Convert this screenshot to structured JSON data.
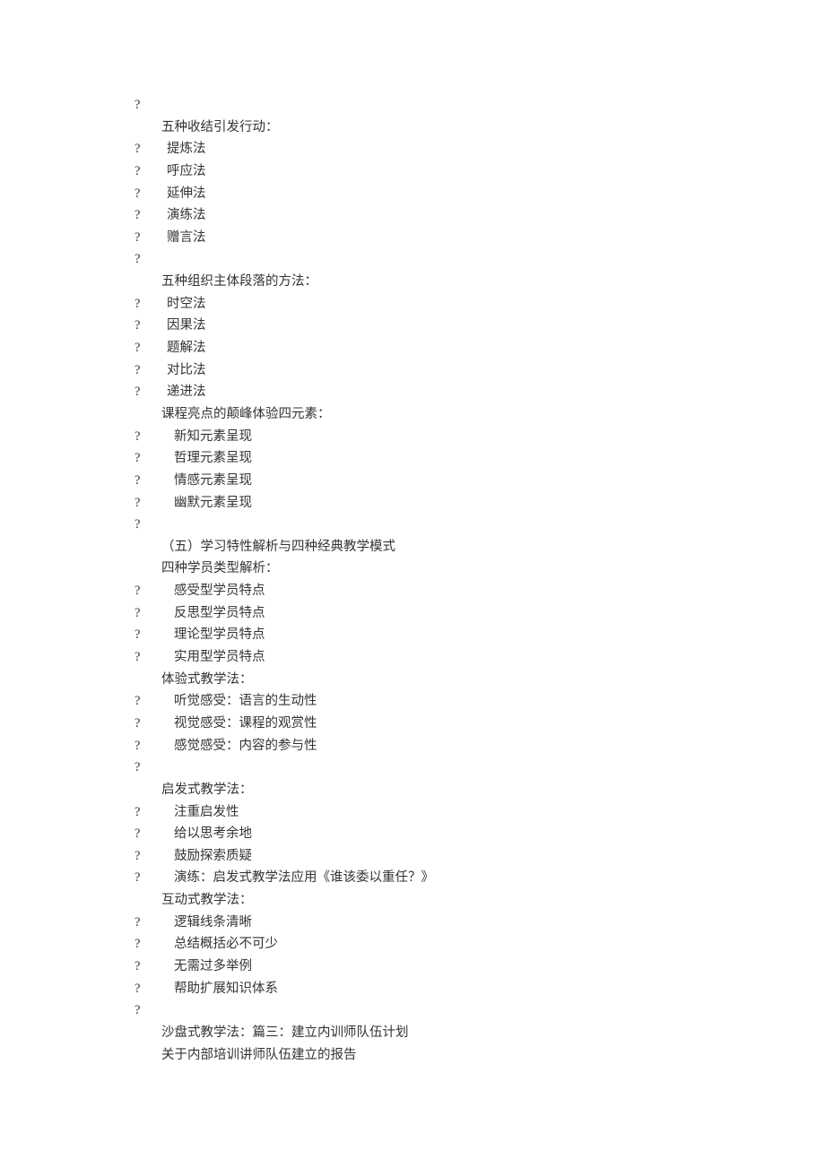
{
  "lines": [
    {
      "type": "q",
      "text": ""
    },
    {
      "type": "indent",
      "text": "五种收结引发行动："
    },
    {
      "type": "qitem",
      "text": "提炼法"
    },
    {
      "type": "qitem",
      "text": "呼应法"
    },
    {
      "type": "qitem",
      "text": "延伸法"
    },
    {
      "type": "qitem",
      "text": "演练法"
    },
    {
      "type": "qitem",
      "text": "赠言法"
    },
    {
      "type": "q",
      "text": ""
    },
    {
      "type": "indent",
      "text": "五种组织主体段落的方法："
    },
    {
      "type": "qitem",
      "text": "时空法"
    },
    {
      "type": "qitem",
      "text": "因果法"
    },
    {
      "type": "qitem",
      "text": "题解法"
    },
    {
      "type": "qitem",
      "text": "对比法"
    },
    {
      "type": "qitem",
      "text": "递进法"
    },
    {
      "type": "indent",
      "text": "课程亮点的颠峰体验四元素："
    },
    {
      "type": "qitem2",
      "text": "新知元素呈现"
    },
    {
      "type": "qitem2",
      "text": "哲理元素呈现"
    },
    {
      "type": "qitem2",
      "text": "情感元素呈现"
    },
    {
      "type": "qitem2",
      "text": "幽默元素呈现"
    },
    {
      "type": "q",
      "text": ""
    },
    {
      "type": "indent",
      "text": "（五）学习特性解析与四种经典教学模式"
    },
    {
      "type": "indent",
      "text": "四种学员类型解析："
    },
    {
      "type": "qitem2",
      "text": "感受型学员特点"
    },
    {
      "type": "qitem2",
      "text": "反思型学员特点"
    },
    {
      "type": "qitem2",
      "text": "理论型学员特点"
    },
    {
      "type": "qitem2",
      "text": "实用型学员特点"
    },
    {
      "type": "indent",
      "text": "体验式教学法："
    },
    {
      "type": "qitem2",
      "text": "听觉感受：语言的生动性"
    },
    {
      "type": "qitem2",
      "text": "视觉感受：课程的观赏性"
    },
    {
      "type": "qitem2",
      "text": "感觉感受：内容的参与性"
    },
    {
      "type": "q",
      "text": ""
    },
    {
      "type": "indent",
      "text": "启发式教学法："
    },
    {
      "type": "qitem2",
      "text": "注重启发性"
    },
    {
      "type": "qitem2",
      "text": "给以思考余地"
    },
    {
      "type": "qitem2",
      "text": "鼓励探索质疑"
    },
    {
      "type": "qitem2",
      "text": "演练：启发式教学法应用《谁该委以重任？》"
    },
    {
      "type": "indent",
      "text": "互动式教学法："
    },
    {
      "type": "qitem2",
      "text": "逻辑线条清晰"
    },
    {
      "type": "qitem2",
      "text": "总结概括必不可少"
    },
    {
      "type": "qitem2",
      "text": "无需过多举例"
    },
    {
      "type": "qitem2",
      "text": "帮助扩展知识体系"
    },
    {
      "type": "q",
      "text": ""
    },
    {
      "type": "indent",
      "text": "沙盘式教学法：篇三：建立内训师队伍计划"
    },
    {
      "type": "indent",
      "text": "关于内部培训讲师队伍建立的报告"
    }
  ]
}
